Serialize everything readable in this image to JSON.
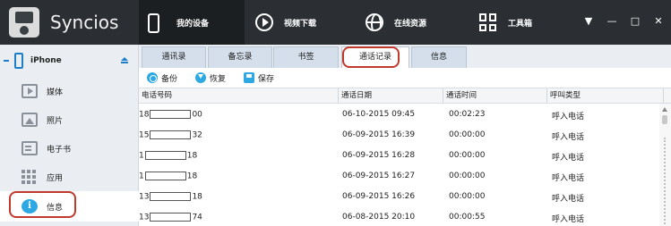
{
  "app": {
    "name": "Syncios"
  },
  "nav": {
    "tabs": [
      {
        "label": "我的设备",
        "icon": "phone-icon"
      },
      {
        "label": "视频下载",
        "icon": "play-icon"
      },
      {
        "label": "在线资源",
        "icon": "globe-icon"
      },
      {
        "label": "工具箱",
        "icon": "toolbox-grid-icon"
      }
    ]
  },
  "window_controls": {
    "menu": "▼",
    "minimize": "—",
    "maximize": "□",
    "close": "✕"
  },
  "sidebar": {
    "device_name": "iPhone",
    "items": [
      {
        "label": "媒体",
        "icon": "media-icon"
      },
      {
        "label": "照片",
        "icon": "photos-icon"
      },
      {
        "label": "电子书",
        "icon": "ebook-icon"
      },
      {
        "label": "应用",
        "icon": "apps-icon"
      },
      {
        "label": "信息",
        "icon": "info-icon",
        "selected": true
      }
    ]
  },
  "subtabs": [
    {
      "label": "通讯录"
    },
    {
      "label": "备忘录"
    },
    {
      "label": "书签"
    },
    {
      "label": "通话记录",
      "selected": true
    },
    {
      "label": "信息"
    }
  ],
  "toolbar": {
    "backup": "备份",
    "restore": "恢复",
    "save": "保存"
  },
  "table": {
    "columns": [
      "电话号码",
      "通话日期",
      "通话时间",
      "呼叫类型"
    ],
    "rows": [
      {
        "phone_prefix": "18",
        "phone_suffix": "00",
        "date": "06-10-2015 09:45",
        "duration": "00:02:23",
        "type": "呼入电话"
      },
      {
        "phone_prefix": "15",
        "phone_suffix": "32",
        "date": "06-09-2015 16:39",
        "duration": "00:00:00",
        "type": "呼入电话"
      },
      {
        "phone_prefix": "1",
        "phone_suffix": "18",
        "date": "06-09-2015 16:28",
        "duration": "00:00:00",
        "type": "呼入电话"
      },
      {
        "phone_prefix": "1",
        "phone_suffix": "18",
        "date": "06-09-2015 16:27",
        "duration": "00:00:00",
        "type": "呼入电话"
      },
      {
        "phone_prefix": "13",
        "phone_suffix": "18",
        "date": "06-09-2015 16:26",
        "duration": "00:00:00",
        "type": "呼入电话"
      },
      {
        "phone_prefix": "13",
        "phone_suffix": "74",
        "date": "06-08-2015 20:10",
        "duration": "00:00:55",
        "type": "呼入电话"
      }
    ]
  },
  "colors": {
    "topbar": "#2b2f33",
    "accent": "#2da8e3",
    "highlight_ring": "#c0392b"
  }
}
